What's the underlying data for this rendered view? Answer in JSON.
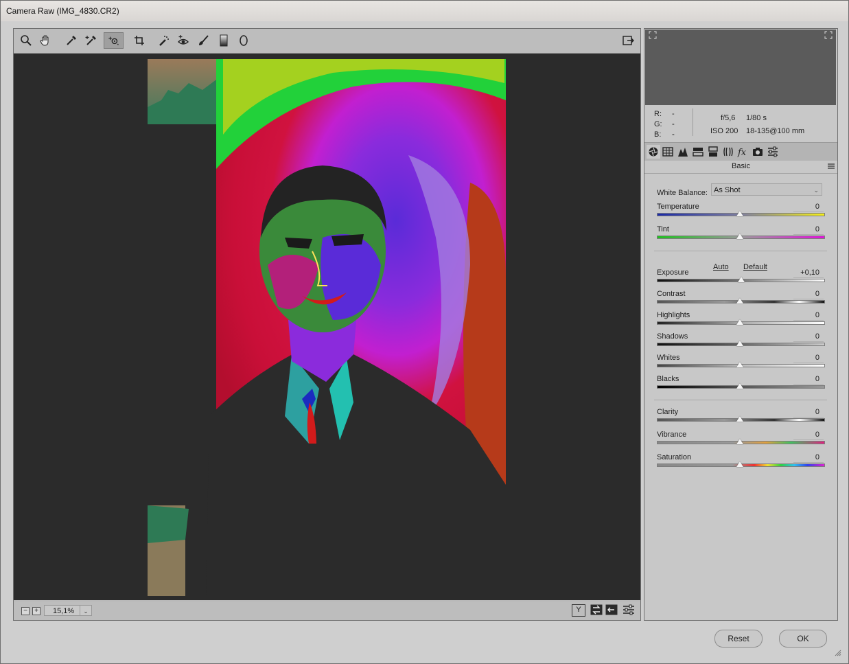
{
  "window": {
    "title": "Camera Raw (IMG_4830.CR2)"
  },
  "toolbar": {
    "tools": [
      "zoom-tool",
      "hand-tool",
      "white-balance-tool",
      "color-sampler-tool",
      "targeted-adjustment-tool",
      "crop-tool",
      "spot-removal-tool",
      "red-eye-removal-tool",
      "adjustment-brush-tool",
      "graduated-filter-tool",
      "radial-filter-tool"
    ],
    "active_tool": "targeted-adjustment-tool",
    "open_preferences": "open-preferences-icon"
  },
  "status": {
    "zoom_minus": "−",
    "zoom_plus": "+",
    "zoom_value": "15,1%",
    "before_after_label": "Y"
  },
  "readout": {
    "r_label": "R:",
    "r_value": "---",
    "g_label": "G:",
    "g_value": "---",
    "b_label": "B:",
    "b_value": "---",
    "aperture": "f/5,6",
    "shutter": "1/80 s",
    "iso": "ISO 200",
    "lens": "18-135@100 mm"
  },
  "panel": {
    "title": "Basic",
    "wb_label": "White Balance:",
    "wb_value": "As Shot",
    "auto": "Auto",
    "default": "Default",
    "sliders": [
      {
        "label": "Temperature",
        "value": "0"
      },
      {
        "label": "Tint",
        "value": "0"
      },
      {
        "label": "Exposure",
        "value": "+0,10"
      },
      {
        "label": "Contrast",
        "value": "0"
      },
      {
        "label": "Highlights",
        "value": "0"
      },
      {
        "label": "Shadows",
        "value": "0"
      },
      {
        "label": "Whites",
        "value": "0"
      },
      {
        "label": "Blacks",
        "value": "0"
      },
      {
        "label": "Clarity",
        "value": "0"
      },
      {
        "label": "Vibrance",
        "value": "0"
      },
      {
        "label": "Saturation",
        "value": "0"
      }
    ]
  },
  "buttons": {
    "reset": "Reset",
    "ok": "OK"
  },
  "colors": {
    "canvas": "#2b2b2b",
    "histogram": "#5b5b5b"
  }
}
